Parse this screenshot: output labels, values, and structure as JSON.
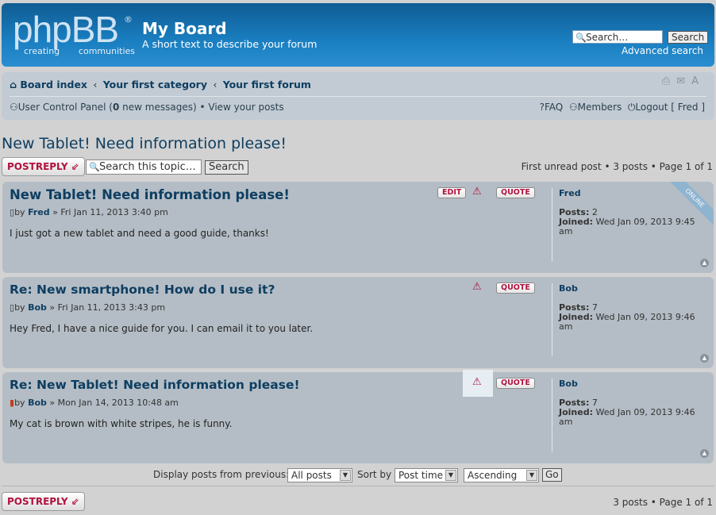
{
  "header": {
    "logo_word": "phpBB",
    "logo_reg": "®",
    "logo_sub_left": "creating",
    "logo_sub_right": "communities",
    "site_title": "My Board",
    "site_desc": "A short text to describe your forum",
    "search_placeholder": "Search…",
    "search_button": "Search",
    "advanced_search": "Advanced search"
  },
  "navbar": {
    "crumbs": [
      "Board index",
      "Your first category",
      "Your first forum"
    ],
    "ucp_label": "User Control Panel (",
    "new_messages_count": "0",
    "new_messages_suffix": " new messages)",
    "view_posts": "View your posts",
    "faq": "FAQ",
    "members": "Members",
    "logout": "Logout [ Fred ]"
  },
  "topic": {
    "title": "New Tablet! Need information please!",
    "postreply_label": "POSTREPLY",
    "search_placeholder": "Search this topic…",
    "search_button": "Search",
    "pagination_top": "First unread post • 3 posts • Page 1 of 1",
    "pagination_bottom": "3 posts • Page 1 of 1"
  },
  "posts": [
    {
      "title": "New Tablet! Need information please!",
      "byline_prefix": "by ",
      "author": "Fred",
      "date": " » Fri Jan 11, 2013 3:40 pm",
      "text": "I just got a new tablet and need a good guide, thanks!",
      "edit_label": "EDIT",
      "quote_label": "QUOTE",
      "posts_label": "Posts:",
      "posts_count": "2",
      "joined_label": "Joined:",
      "joined_date": "Wed Jan 09, 2013 9:45",
      "joined_ampm": "am",
      "online_label": "ONLINE"
    },
    {
      "title": "Re: New smartphone! How do I use it?",
      "byline_prefix": "by ",
      "author": "Bob",
      "date": " » Fri Jan 11, 2013 3:43 pm",
      "text": "Hey Fred, I have a nice guide for you. I can email it to you later.",
      "quote_label": "QUOTE",
      "posts_label": "Posts:",
      "posts_count": "7",
      "joined_label": "Joined:",
      "joined_date": "Wed Jan 09, 2013 9:46",
      "joined_ampm": "am"
    },
    {
      "title": "Re: New Tablet! Need information please!",
      "byline_prefix": "by ",
      "author": "Bob",
      "date": " » Mon Jan 14, 2013 10:48 am",
      "text": "My cat is brown with white stripes, he is funny.",
      "quote_label": "QUOTE",
      "posts_label": "Posts:",
      "posts_count": "7",
      "joined_label": "Joined:",
      "joined_date": "Wed Jan 09, 2013 9:46",
      "joined_ampm": "am"
    }
  ],
  "display_bar": {
    "label": "Display posts from previous:",
    "days_value": "All posts",
    "sort_label": "Sort by",
    "sort_value": "Post time",
    "direction_value": "Ascending",
    "go_button": "Go"
  }
}
